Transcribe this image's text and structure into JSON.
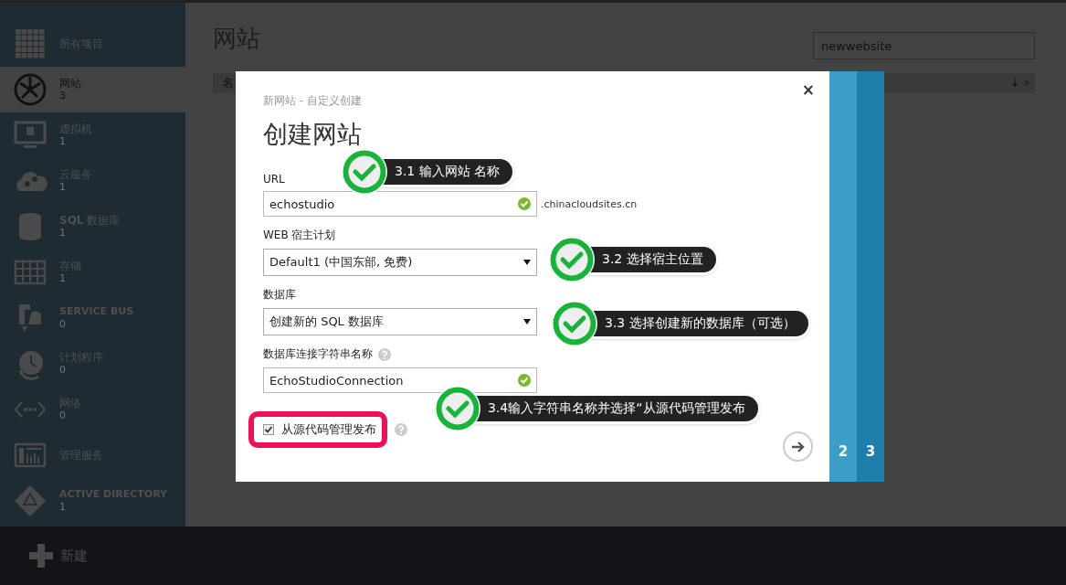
{
  "sidebar": {
    "items": [
      {
        "label": "所有项目",
        "selected": false
      },
      {
        "label": "网站",
        "count": "3",
        "selected": true
      },
      {
        "label": "虚拟机",
        "count": "1",
        "selected": false
      },
      {
        "label": "云服务",
        "count": "1",
        "selected": false
      },
      {
        "label": "**SQL** 数据库",
        "count": "1",
        "selected": false
      },
      {
        "label": "存储",
        "count": "1",
        "selected": false
      },
      {
        "label": "SERVICE BUS",
        "count": "0",
        "selected": false,
        "bold": true
      },
      {
        "label": "计划程序",
        "count": "0",
        "selected": false
      },
      {
        "label": "网络",
        "count": "0",
        "selected": false
      },
      {
        "label": "管理服务",
        "selected": false
      },
      {
        "label": "ACTIVE DIRECTORY",
        "count": "1",
        "selected": false,
        "bold": true
      }
    ]
  },
  "page": {
    "title": "网站",
    "search": {
      "value": "newwebsite"
    },
    "table": {
      "columns": [
        "名"
      ]
    }
  },
  "command_bar": {
    "new_label": "新建"
  },
  "dialog": {
    "breadcrumb": "新网站 - 自定义创建",
    "title": "创建网站",
    "close": "×",
    "fields": [
      {
        "kind": "text",
        "label": "URL",
        "value": "echostudio",
        "valid": true,
        "suffix": ".chinacloudsites.cn"
      },
      {
        "kind": "select",
        "label": "WEB 宿主计划",
        "value": "Default1 (中国东部, 免费)"
      },
      {
        "kind": "select",
        "label": "数据库",
        "value": "创建新的 SQL 数据库"
      },
      {
        "kind": "text",
        "label": "数据库连接字符串名称",
        "help": true,
        "value": "EchoStudioConnection",
        "valid": true
      },
      {
        "kind": "checkbox",
        "label": "从源代码管理发布",
        "checked": true,
        "help": true,
        "highlighted": true
      }
    ],
    "steps": [
      {
        "label": "2",
        "color": "#3b9dc8"
      },
      {
        "label": "3",
        "color": "#1e7fac"
      }
    ]
  },
  "callouts": [
    {
      "text": "3.1 输入网站 名称"
    },
    {
      "text": "3.2 选择宿主位置"
    },
    {
      "text": "3.3 选择创建新的数据库（可选）"
    },
    {
      "text": "3.4输入字符串名称并选择“从源代码管理发布"
    }
  ]
}
